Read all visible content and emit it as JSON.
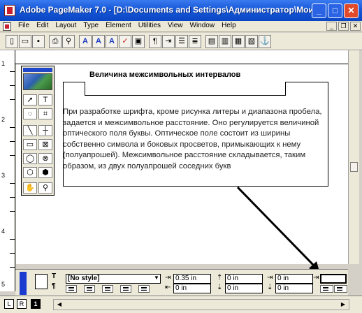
{
  "window": {
    "title": "Adobe PageMaker 7.0 - [D:\\Documents and Settings\\Администратор\\Мои ...",
    "minimize_icon": "minimize-icon",
    "maximize_icon": "maximize-icon",
    "close_icon": "close-icon"
  },
  "menubar": {
    "items": [
      "File",
      "Edit",
      "Layout",
      "Type",
      "Element",
      "Utilities",
      "View",
      "Window",
      "Help"
    ]
  },
  "toolbar": {
    "buttons": [
      "new-icon",
      "open-icon",
      "save-icon",
      "print-icon",
      "find-icon",
      "font-icon",
      "font-size-icon",
      "kerning-icon",
      "spell-check-icon",
      "insert-object-icon",
      "paragraph-icon",
      "indent-icon",
      "bullets-icon",
      "numbering-icon",
      "style-icon",
      "color-icon",
      "frame-icon",
      "place-icon",
      "hyperlink-icon"
    ]
  },
  "vruler": {
    "labels": [
      "1",
      "2",
      "3",
      "4",
      "5"
    ]
  },
  "document": {
    "headline": "Величина межсимвольных интервалов",
    "body": "При разработке шрифта, кроме рисунка литеры и диапазона пробела, задается и межсимвольное расстояние. Оно регулируется величиной оптического поля буквы. Оптическое поле состоит из ширины собственно символа и боковых просветов, примыкающих к нему (полуапрошей). Межсимвольное расстояние складывается, таким образом, из двух полуапрошей соседних букв"
  },
  "toolbox": {
    "tools": [
      "pointer-tool-icon",
      "text-tool-icon",
      "rotate-tool-icon",
      "crop-tool-icon",
      "line-tool-icon",
      "constrained-line-tool-icon",
      "rectangle-tool-icon",
      "rectangle-frame-tool-icon",
      "ellipse-tool-icon",
      "ellipse-frame-tool-icon",
      "polygon-tool-icon",
      "polygon-frame-tool-icon",
      "hand-tool-icon",
      "zoom-tool-icon"
    ]
  },
  "palette": {
    "style_value": "[No style]",
    "indent_left": "0.35 in",
    "indent_first": "0 in",
    "space_before": "0 in",
    "space_after": "0 in",
    "indent_right": "0 in",
    "grid": "0 in",
    "extra": "0 in"
  },
  "bottombar": {
    "left_label": "L",
    "right_label": "R",
    "current_page": "1"
  }
}
